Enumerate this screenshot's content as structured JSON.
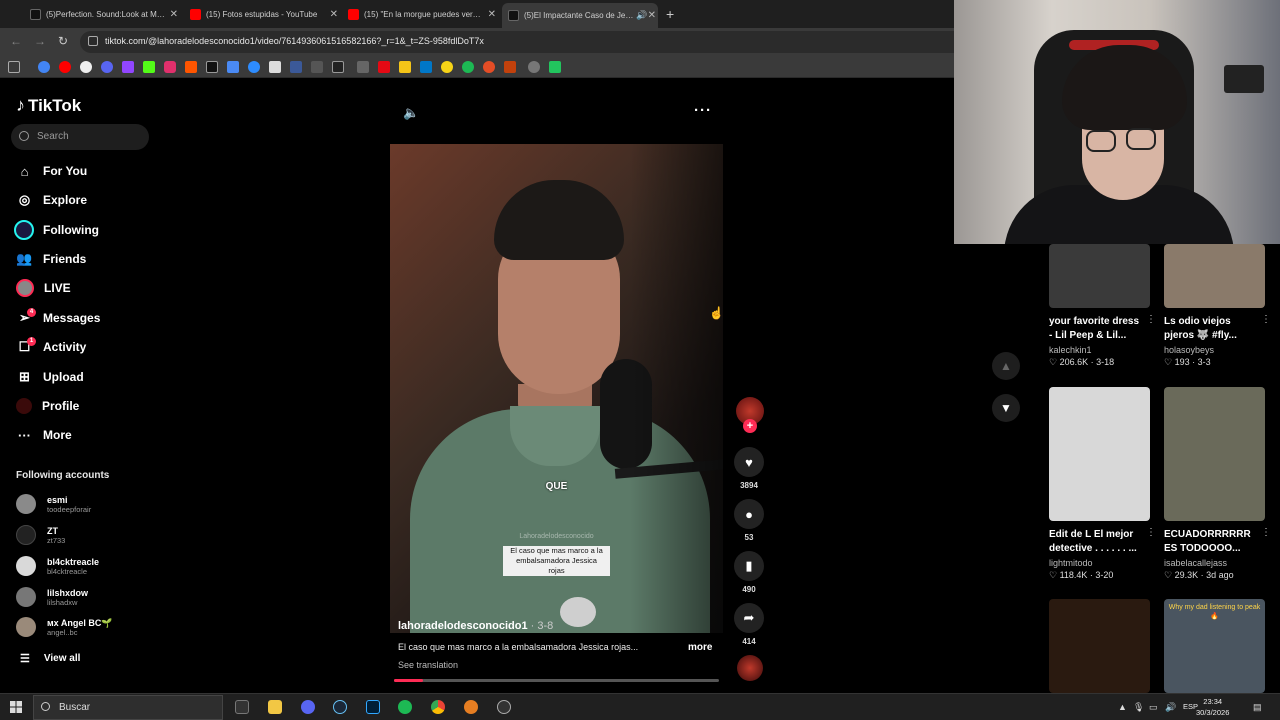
{
  "browser": {
    "tabs": [
      {
        "label": "(5)Perfection. Sound:Look at M…",
        "color": "#111111"
      },
      {
        "label": "(15) Fotos estupidas - YouTube",
        "color": "#ff0000"
      },
      {
        "label": "(15) \"En la morgue puedes ver…",
        "color": "#ff0000"
      },
      {
        "label": "(5)El Impactante Caso de Je…",
        "color": "#111111"
      }
    ],
    "new_tab": "+",
    "url": "tiktok.com/@lahoradelodesconocido1/video/7614936061516582166?_r=1&_t=ZS-958fdlDoT7x"
  },
  "sidebar": {
    "logo": "TikTok",
    "search_placeholder": "Search",
    "nav": [
      {
        "label": "For You",
        "icon": "home-icon"
      },
      {
        "label": "Explore",
        "icon": "compass-icon"
      },
      {
        "label": "Following",
        "icon": "following-icon"
      },
      {
        "label": "Friends",
        "icon": "friends-icon"
      },
      {
        "label": "LIVE",
        "icon": "live-icon"
      },
      {
        "label": "Messages",
        "icon": "send-icon",
        "badge": "4"
      },
      {
        "label": "Activity",
        "icon": "activity-icon",
        "badge": "1"
      },
      {
        "label": "Upload",
        "icon": "upload-icon"
      },
      {
        "label": "Profile",
        "icon": "profile-icon"
      },
      {
        "label": "More",
        "icon": "more-icon"
      }
    ],
    "following_title": "Following accounts",
    "accounts": [
      {
        "name": "esmi",
        "handle": "toodeepforair",
        "color": "#8a8a8a"
      },
      {
        "name": "ZT",
        "handle": "zt733",
        "color": "#222222"
      },
      {
        "name": "bl4cktreacle",
        "handle": "bl4cktreacle",
        "color": "#d9d9d9"
      },
      {
        "name": "lilshxdow",
        "handle": "lilshadxw",
        "color": "#777777"
      },
      {
        "name": "ᴍx Angel BC🌱",
        "handle": "angel..bc",
        "color": "#9a8a7a"
      }
    ],
    "view_all": "View all"
  },
  "video": {
    "overlay_word": "QUE",
    "watermark": "Lahoradelodesconocido",
    "caption_lines": [
      "El caso que mas marco a la",
      "embalsamadora  Jessica",
      "rojas"
    ],
    "author": "lahoradelodesconocido1",
    "date": " · 3-8",
    "description": "El caso que mas marco a la embalsamadora  Jessica rojas...",
    "more": "more",
    "see_translation": "See translation",
    "progress": 0.09
  },
  "actions": {
    "likes": "3894",
    "comments": "53",
    "saves": "490",
    "shares": "414"
  },
  "feed": [
    {
      "title1": "your favorite dress",
      "title2": "- Lil Peep & Lil...",
      "user": "kalechkin1",
      "stats": "♡ 206.6K · 3-18",
      "color": "#3a3a3a"
    },
    {
      "title1": "Ls odio viejos",
      "title2": "pjeros 🐺 #fly...",
      "user": "holasoybeys",
      "stats": "♡ 193 · 3-3",
      "color": "#8a7a6a"
    },
    {
      "title1": "Edit de L El mejor",
      "title2": "detective . . . . . . ...",
      "user": "lightmitodo",
      "stats": "♡ 118.4K · 3-20",
      "color": "#d8d8d8"
    },
    {
      "title1": "ECUADORRRRRR",
      "title2": "ES TODOOOO...",
      "user": "isabelacallejass",
      "stats": "♡ 29.3K · 3d ago",
      "color": "#6a6a5a"
    },
    {
      "title1": "",
      "title2": "",
      "user": "",
      "stats": "",
      "color": "#2a1a10"
    },
    {
      "title1": "Why my dad listening to peak 🔥",
      "title2": "",
      "user": "",
      "stats": "",
      "color": "#4a5560"
    }
  ],
  "taskbar": {
    "search": "Buscar",
    "lang": "ESP",
    "time": "23:34",
    "date": "30/3/2026"
  },
  "colors": {
    "accent": "#fe2c55",
    "bg": "#000000"
  }
}
